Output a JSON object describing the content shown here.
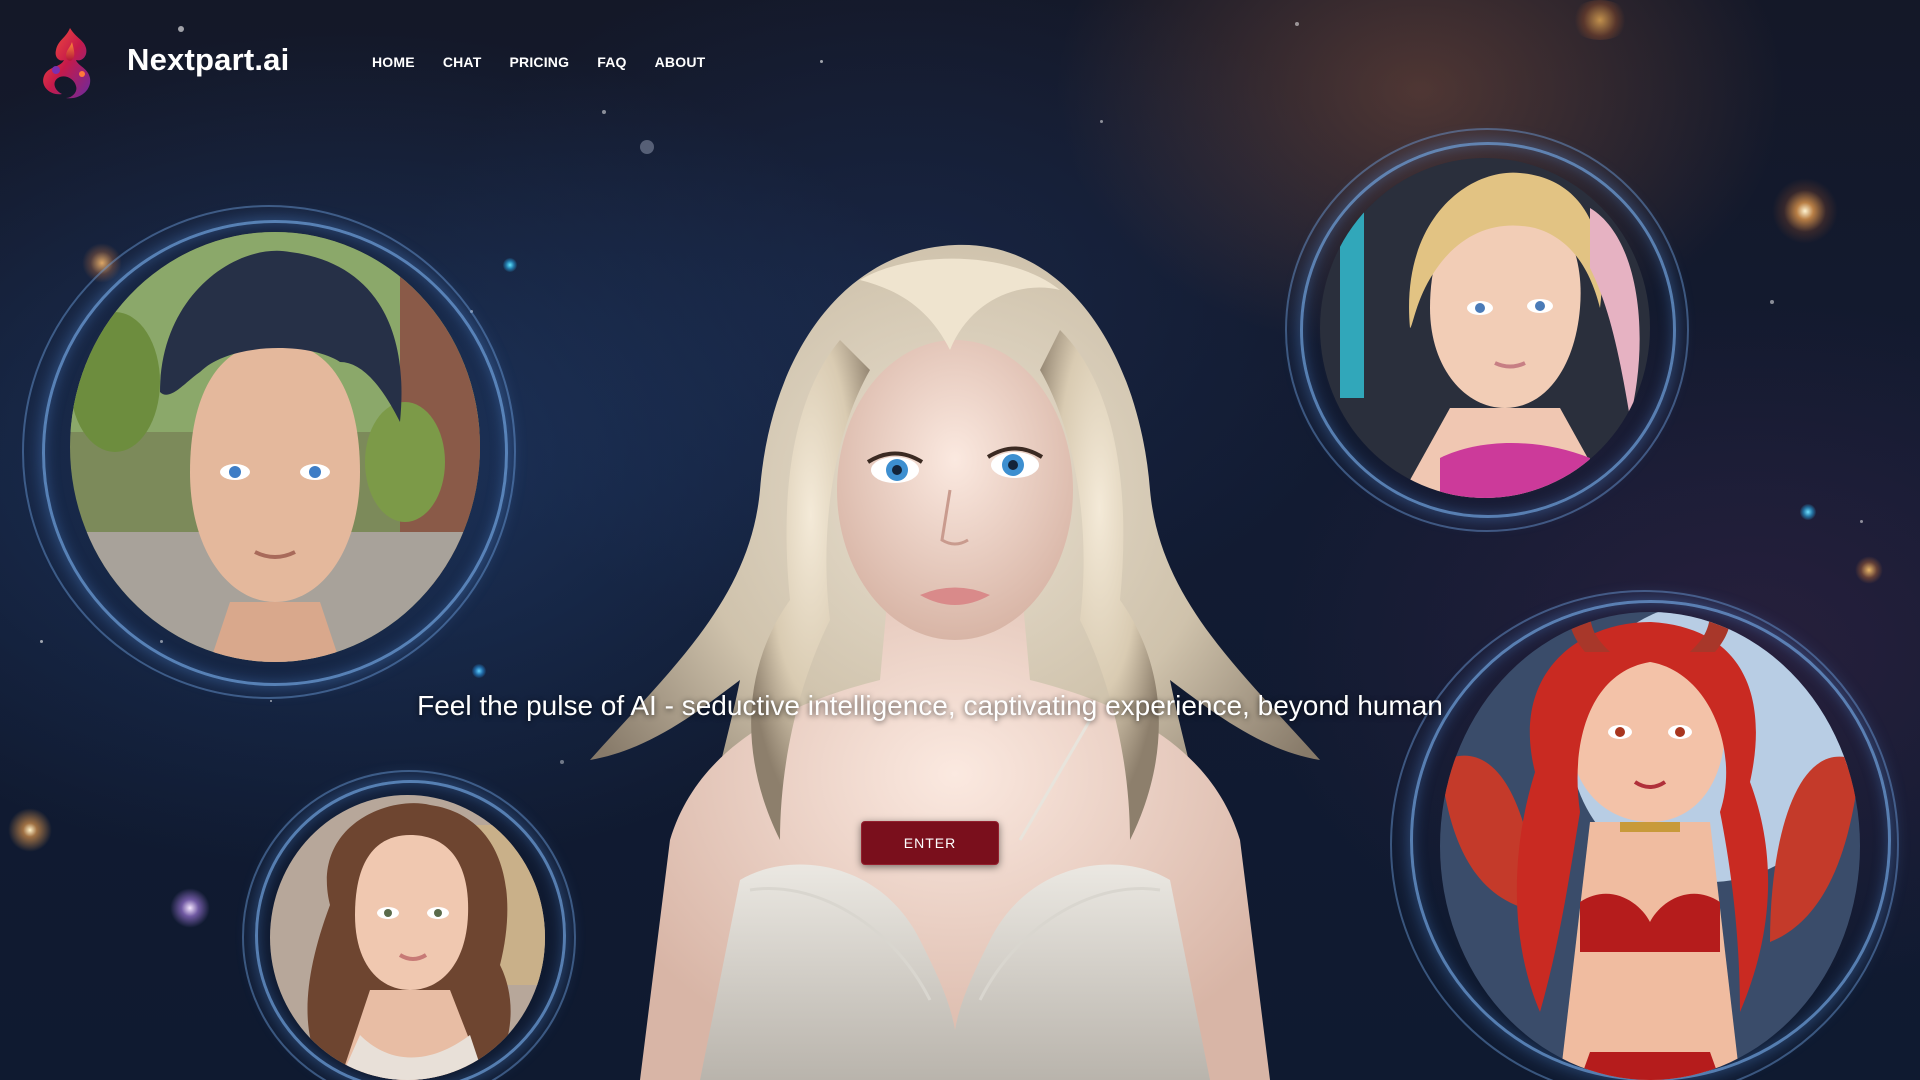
{
  "brand": {
    "name": "Nextpart.ai",
    "logo_icon": "flame-swirl-logo-icon"
  },
  "nav": {
    "items": [
      {
        "label": "HOME"
      },
      {
        "label": "CHAT"
      },
      {
        "label": "PRICING"
      },
      {
        "label": "FAQ"
      },
      {
        "label": "ABOUT"
      }
    ]
  },
  "hero": {
    "tagline": "Feel the pulse of AI - seductive intelligence, captivating experience, beyond human",
    "enter_label": "ENTER"
  },
  "portraits": [
    {
      "name": "dark-haired-man-portrait"
    },
    {
      "name": "blonde-ponytail-woman-portrait"
    },
    {
      "name": "brunette-woman-portrait"
    },
    {
      "name": "red-haired-demon-woman-portrait"
    },
    {
      "name": "central-blonde-woman-figure"
    }
  ],
  "colors": {
    "background": "#121b32",
    "enter_button": "#7a0f1c",
    "ring": "#6ea0dc",
    "text": "#ffffff"
  }
}
